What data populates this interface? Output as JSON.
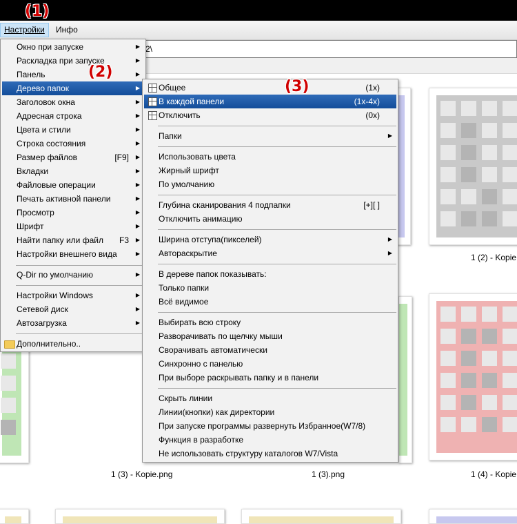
{
  "annotations": [
    "(1)",
    "(2)",
    "(3)"
  ],
  "menubar": {
    "settings": "Настройки",
    "info": "Инфо"
  },
  "address": {
    "value": "2\\"
  },
  "captions": [
    "1 (2) - Kopie",
    "1 (3) - Kopie.png",
    "1 (3).png",
    "1 (4) - Kopie"
  ],
  "colors": {
    "highlight": "#134d9a",
    "annotation": "#d00000",
    "green": "#bfe6b5",
    "red": "#efb2b2",
    "blue": "#c7c8ef",
    "yellow": "#f0e5b8"
  },
  "settings_menu": {
    "items": [
      {
        "label": "Окно при запуске",
        "submenu": true
      },
      {
        "label": "Раскладка при запуске",
        "submenu": true
      },
      {
        "label": "Панель",
        "submenu": true
      },
      {
        "label": "Дерево папок",
        "submenu": true,
        "highlighted": true
      },
      {
        "label": "Заголовок окна",
        "submenu": true
      },
      {
        "label": "Адресная строка",
        "submenu": true
      },
      {
        "label": "Цвета и стили",
        "submenu": true
      },
      {
        "label": "Строка состояния",
        "submenu": true
      },
      {
        "label": "Размер файлов",
        "shortcut": "[F9]",
        "submenu": true
      },
      {
        "label": "Вкладки",
        "submenu": true
      },
      {
        "label": "Файловые операции",
        "submenu": true
      },
      {
        "label": "Печать активной панели",
        "submenu": true
      },
      {
        "label": "Просмотр",
        "submenu": true
      },
      {
        "label": "Шрифт",
        "submenu": true
      },
      {
        "label": "Найти папку или файл",
        "shortcut": "F3",
        "submenu": true
      },
      {
        "label": "Настройки внешнего вида",
        "submenu": true
      },
      {
        "label": "Q-Dir по умолчанию",
        "submenu": true
      },
      {
        "label": "Настройки Windows",
        "submenu": true
      },
      {
        "label": "Сетевой диск",
        "submenu": true
      },
      {
        "label": "Автозагрузка",
        "submenu": true
      },
      {
        "label": "Дополнительно..",
        "icon": "folder-icon"
      }
    ]
  },
  "tree_menu": {
    "items": [
      {
        "label": "Общее",
        "shortcut": "(1x)",
        "icon": "grid-icon"
      },
      {
        "label": "В каждой панели",
        "shortcut": "(1x-4x)",
        "icon": "grid-icon",
        "highlighted": true
      },
      {
        "label": "Отключить",
        "shortcut": "(0x)",
        "icon": "grid-icon"
      },
      {
        "label": "Папки",
        "submenu": true
      },
      {
        "label": "Использовать цвета"
      },
      {
        "label": "Жирный шрифт"
      },
      {
        "label": "По умолчанию"
      },
      {
        "label": "Глубина сканирования 4 подпапки",
        "shortcut": "[+][ ]"
      },
      {
        "label": "Отключить анимацию"
      },
      {
        "label": "Ширина отступа(пикселей)",
        "submenu": true
      },
      {
        "label": "Автораскрытие",
        "submenu": true
      },
      {
        "label": "В дереве папок показывать:"
      },
      {
        "label": "Только папки"
      },
      {
        "label": "Всё видимое"
      },
      {
        "label": "Выбирать всю строку"
      },
      {
        "label": "Разворачивать по щелчку мыши"
      },
      {
        "label": "Сворачивать автоматически"
      },
      {
        "label": "Синхронно с панелью"
      },
      {
        "label": "При выборе раскрывать папку и в панели"
      },
      {
        "label": "Скрыть линии"
      },
      {
        "label": "Линии(кнопки) как директории"
      },
      {
        "label": "При запуске программы развернуть Избранное(W7/8)"
      },
      {
        "label": "Функция в разработке"
      },
      {
        "label": "Не использовать структуру каталогов W7/Vista"
      }
    ]
  }
}
